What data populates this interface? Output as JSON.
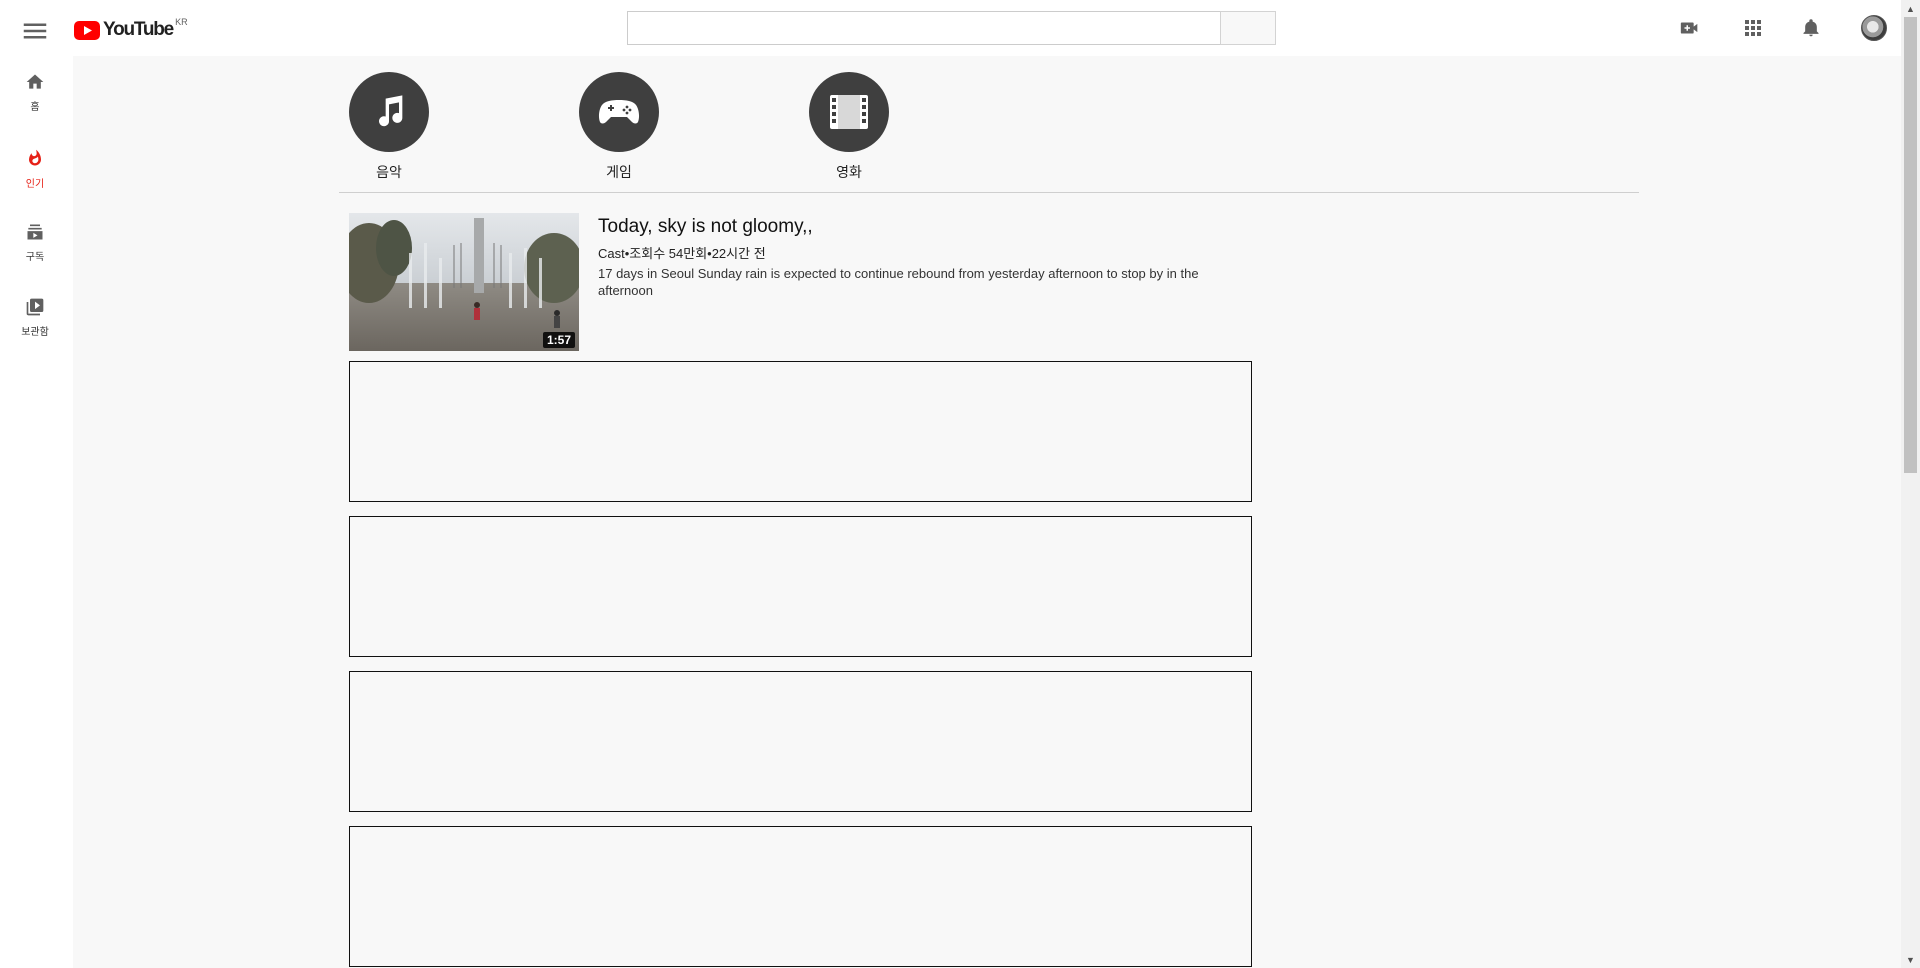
{
  "header": {
    "logo_text": "YouTube",
    "logo_country": "KR",
    "search_placeholder": "",
    "search_value": "",
    "icons": [
      "menu-icon",
      "video-upload-icon",
      "apps-grid-icon",
      "notifications-bell-icon"
    ]
  },
  "guide": {
    "items": [
      {
        "label": "홈",
        "icon": "home-icon"
      },
      {
        "label": "인기",
        "icon": "trending-flame-icon",
        "active": true
      },
      {
        "label": "구독",
        "icon": "subscriptions-icon"
      },
      {
        "label": "보관함",
        "icon": "library-icon"
      }
    ]
  },
  "categories": [
    {
      "label": "음악",
      "icon": "music-note-icon"
    },
    {
      "label": "게임",
      "icon": "gamepad-icon"
    },
    {
      "label": "영화",
      "icon": "film-icon"
    }
  ],
  "video": {
    "title": "Today, sky is not gloomy,,",
    "meta": "Cast•조회수 54만회•22시간 전",
    "description": "17 days in Seoul Sunday rain is expected to continue rebound from yesterday afternoon to stop by in the afternoon",
    "duration": "1:57"
  },
  "colors": {
    "brand_red": "#ff0000",
    "active_red": "#e62117",
    "category_circle": "#3f3f3f",
    "content_bg": "#f8f8f8"
  }
}
